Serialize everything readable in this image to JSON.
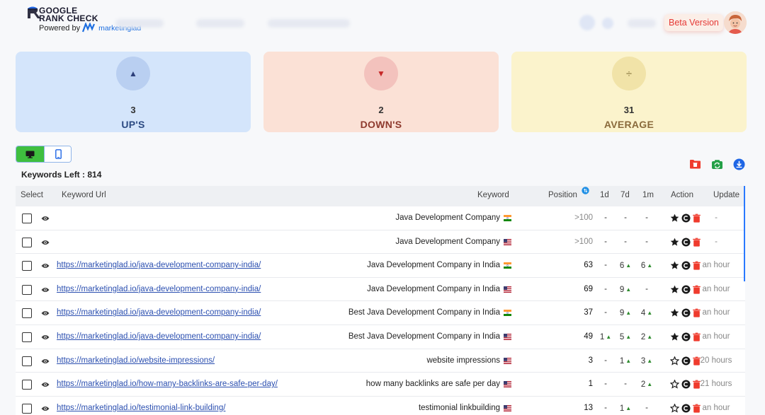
{
  "header": {
    "logo_title_line1": "GOOGLE",
    "logo_title_line2": "RANK CHECK",
    "powered_by": "Powered by",
    "brand": "marketinglad",
    "beta_label": "Beta Version"
  },
  "stats": {
    "ups": {
      "value": "3",
      "label": "UP'S",
      "icon": "triangle-up-icon"
    },
    "downs": {
      "value": "2",
      "label": "DOWN'S",
      "icon": "triangle-down-icon"
    },
    "average": {
      "value": "31",
      "label": "AVERAGE",
      "icon": "divide-icon"
    }
  },
  "device_toggle": {
    "active": "desktop",
    "options": [
      "desktop-icon",
      "mobile-icon"
    ]
  },
  "keywords_left": "Keywords Left : 814",
  "toolbar": [
    "folder-delete-icon",
    "refresh-image-icon",
    "download-icon"
  ],
  "colors": {
    "accent_green": "#3fbf3f",
    "link_blue": "#2b4fb0",
    "delete_red": "#e53935",
    "up_green": "#2e8b2e"
  },
  "table": {
    "headers": {
      "select": "Select",
      "keyword_url": "Keyword Url",
      "keyword": "Keyword",
      "position": "Position",
      "d1": "1d",
      "d7": "7d",
      "m1": "1m",
      "action": "Action",
      "update": "Update"
    },
    "rows": [
      {
        "url": "",
        "keyword": "Java Development Company",
        "flag": "IN",
        "position": ">100",
        "d1": "-",
        "d7": "-",
        "m1": "-",
        "starred": true,
        "update": "-"
      },
      {
        "url": "",
        "keyword": "Java Development Company",
        "flag": "US",
        "position": ">100",
        "d1": "-",
        "d7": "-",
        "m1": "-",
        "starred": true,
        "update": "-"
      },
      {
        "url": "https://marketinglad.io/java-development-company-india/",
        "keyword": "Java Development Company in India",
        "flag": "IN",
        "position": "63",
        "d1": "-",
        "d7": "6",
        "m1": "6",
        "starred": true,
        "update": "an hour"
      },
      {
        "url": "https://marketinglad.io/java-development-company-india/",
        "keyword": "Java Development Company in India",
        "flag": "US",
        "position": "69",
        "d1": "-",
        "d7": "9",
        "m1": "-",
        "starred": true,
        "update": "an hour"
      },
      {
        "url": "https://marketinglad.io/java-development-company-india/",
        "keyword": "Best Java Development Company in India",
        "flag": "IN",
        "position": "37",
        "d1": "-",
        "d7": "9",
        "m1": "4",
        "starred": true,
        "update": "an hour"
      },
      {
        "url": "https://marketinglad.io/java-development-company-india/",
        "keyword": "Best Java Development Company in India",
        "flag": "US",
        "position": "49",
        "d1": "1",
        "d7": "5",
        "m1": "2",
        "starred": true,
        "update": "an hour"
      },
      {
        "url": "https://marketinglad.io/website-impressions/",
        "keyword": "website impressions",
        "flag": "US",
        "position": "3",
        "d1": "-",
        "d7": "1",
        "m1": "3",
        "starred": false,
        "update": "20 hours"
      },
      {
        "url": "https://marketinglad.io/how-many-backlinks-are-safe-per-day/",
        "keyword": "how many backlinks are safe per day",
        "flag": "US",
        "position": "1",
        "d1": "-",
        "d7": "-",
        "m1": "2",
        "starred": false,
        "update": "21 hours"
      },
      {
        "url": "https://marketinglad.io/testimonial-link-building/",
        "keyword": "testimonial linkbuilding",
        "flag": "US",
        "position": "13",
        "d1": "-",
        "d7": "1",
        "m1": "-",
        "starred": false,
        "update": "an hour"
      }
    ]
  }
}
